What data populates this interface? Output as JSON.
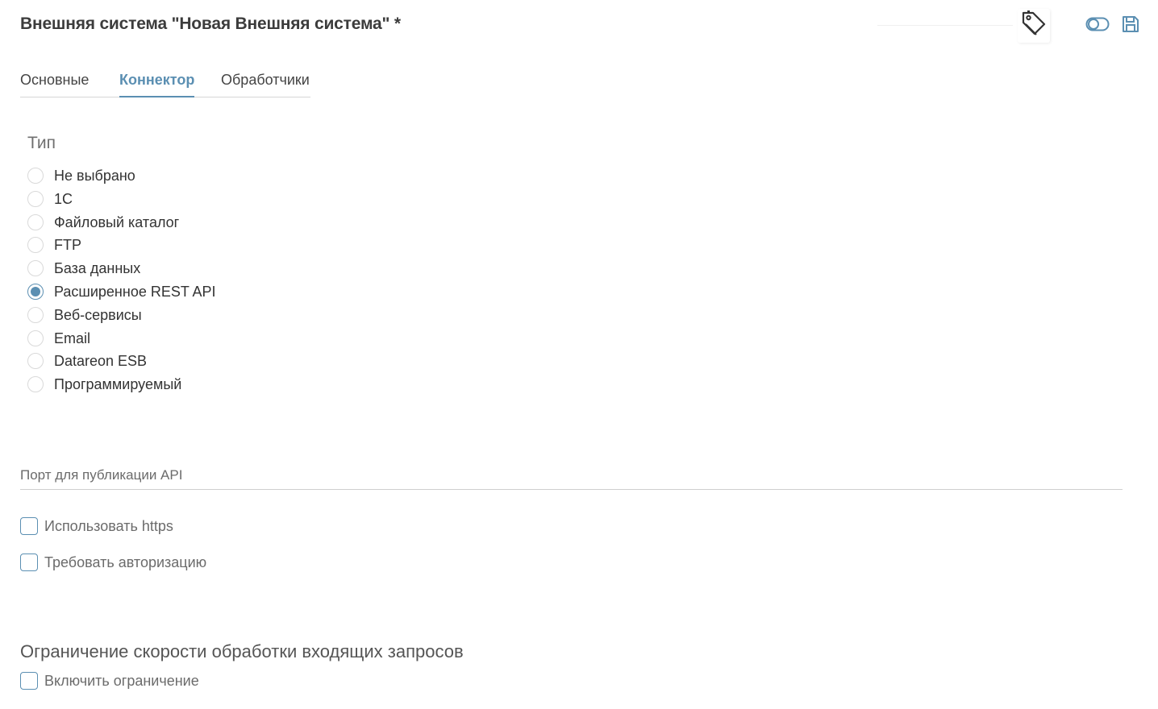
{
  "header": {
    "title": "Внешняя система \"Новая Внешняя система\" *",
    "tag_icon": "tag-icon",
    "toggle_icon": "toggle-icon",
    "save_icon": "save-icon",
    "accent_color": "#5b8fb2"
  },
  "tabs": [
    {
      "label": "Основные",
      "active": false
    },
    {
      "label": "Коннектор",
      "active": true
    },
    {
      "label": "Обработчики",
      "active": false
    }
  ],
  "type_group": {
    "label": "Тип",
    "options": [
      {
        "label": "Не выбрано",
        "checked": false
      },
      {
        "label": "1C",
        "checked": false
      },
      {
        "label": "Файловый каталог",
        "checked": false
      },
      {
        "label": "FTP",
        "checked": false
      },
      {
        "label": "База данных",
        "checked": false
      },
      {
        "label": "Расширенное REST API",
        "checked": true
      },
      {
        "label": "Веб-сервисы",
        "checked": false
      },
      {
        "label": "Email",
        "checked": false
      },
      {
        "label": "Datareon ESB",
        "checked": false
      },
      {
        "label": "Программируемый",
        "checked": false
      }
    ]
  },
  "port_field": {
    "label": "Порт для публикации API",
    "value": ""
  },
  "options": {
    "use_https": {
      "label": "Использовать https",
      "checked": false
    },
    "require_auth": {
      "label": "Требовать авторизацию",
      "checked": false
    }
  },
  "rate_limit": {
    "title": "Ограничение скорости обработки входящих запросов",
    "enable": {
      "label": "Включить ограничение",
      "checked": false
    }
  }
}
